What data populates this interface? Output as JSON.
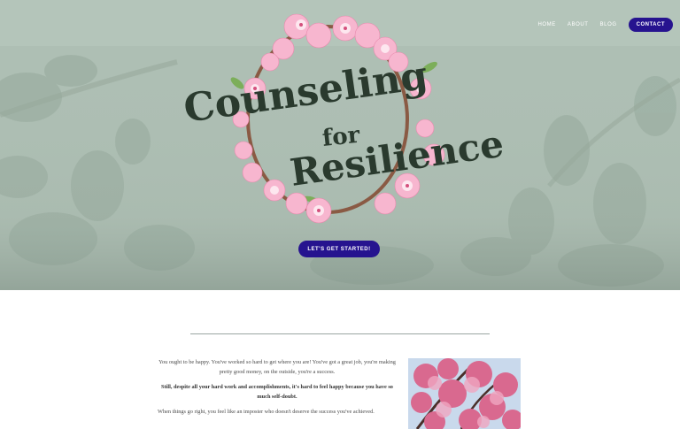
{
  "nav": {
    "items": [
      "HOME",
      "ABOUT",
      "BLOG"
    ],
    "contact_label": "CONTACT"
  },
  "hero": {
    "title_line1": "Counseling",
    "title_line2": "for",
    "title_line3": "Resilience",
    "cta_label": "LET'S GET STARTED!"
  },
  "content": {
    "p1": "You ought to be happy. You've worked so hard to get where you are! You've got a great job, you're making pretty good money, on the outside, you're a success.",
    "p2": "Still, despite all your hard work and accomplishments, it's hard to feel happy because you have so much self-doubt.",
    "p3": "When things go right, you feel like an imposter who doesn't deserve the success you've achieved."
  },
  "colors": {
    "accent": "#26138f",
    "hero_bg": "#aebfb4",
    "title": "#2a3a2e",
    "blossom": "#f2a7c3"
  }
}
